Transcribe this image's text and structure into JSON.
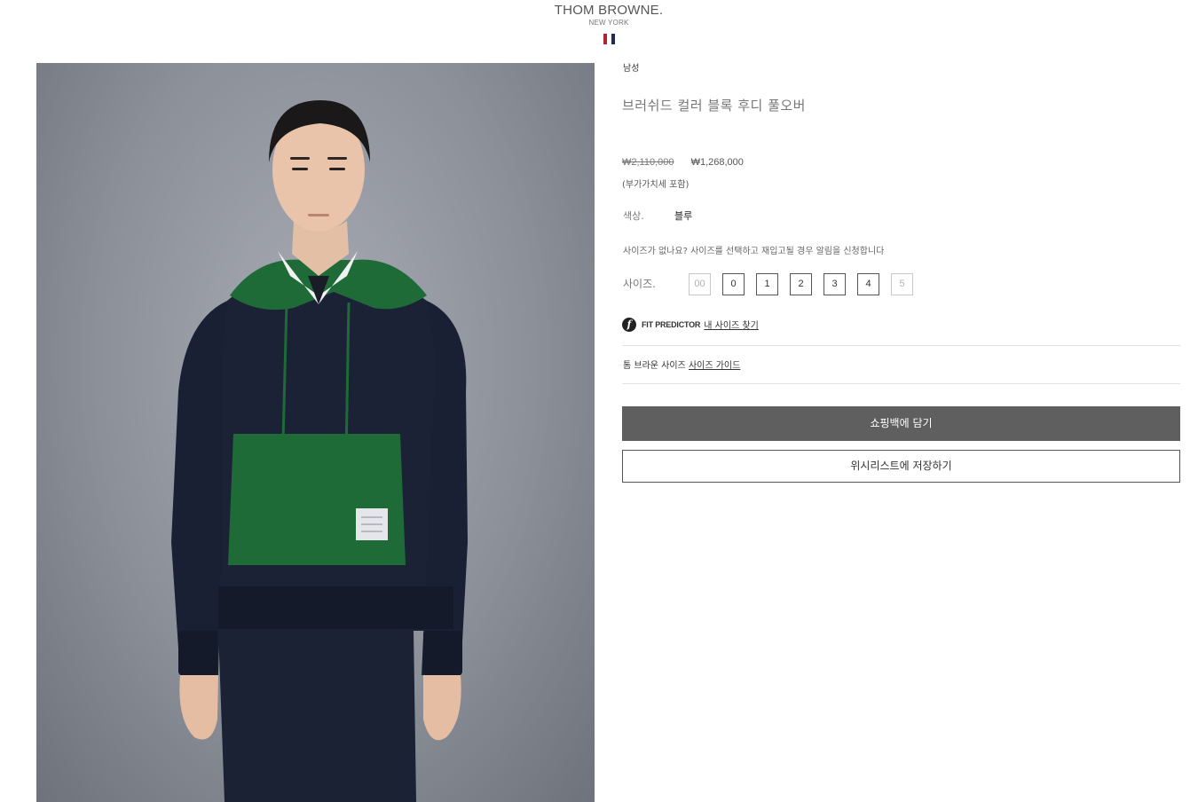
{
  "header": {
    "brand": "THOM BROWNE.",
    "location": "NEW YORK",
    "flag_colors": [
      "#b4232f",
      "#ffffff",
      "#1f2a55"
    ]
  },
  "product": {
    "image_alt": "브러쉬드 컬러 블록 후디 풀오버",
    "category": "남성",
    "title": "브러쉬드 컬러 블록 후디 풀오버",
    "price_original": "₩2,110,000",
    "price_sale": "₩1,268,000",
    "vat_note": "(부가가치세 포함)",
    "color_label": "색상.",
    "color_value": "블루",
    "size_notice": "사이즈가 없나요? 사이즈를 선택하고 재입고될 경우 알림을 신청합니다",
    "size_label": "사이즈.",
    "sizes": [
      {
        "label": "00",
        "available": false
      },
      {
        "label": "0",
        "available": true
      },
      {
        "label": "1",
        "available": true
      },
      {
        "label": "2",
        "available": true
      },
      {
        "label": "3",
        "available": true
      },
      {
        "label": "4",
        "available": true
      },
      {
        "label": "5",
        "available": false
      }
    ],
    "fit_predictor": {
      "icon": "f",
      "brand": "FIT PREDICTOR",
      "link": "내 사이즈 찾기"
    },
    "size_guide": {
      "prefix": "톰 브라운 사이즈",
      "link": "사이즈 가이드"
    },
    "add_to_bag": "쇼핑백에 담기",
    "add_to_wishlist": "위시리스트에 저장하기"
  },
  "colors": {
    "primary_button": "#5f5f5f",
    "hoodie_navy": "#1c2236",
    "hoodie_green": "#1e6a38"
  }
}
